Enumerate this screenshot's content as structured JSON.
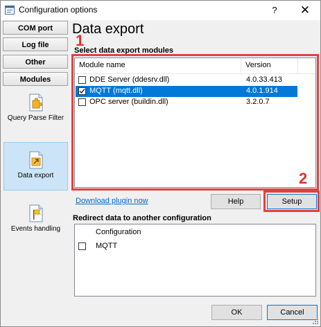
{
  "window": {
    "title": "Configuration options",
    "help_glyph": "?",
    "close_glyph": "✕"
  },
  "sidebar": {
    "tabs": [
      "COM port",
      "Log file",
      "Other",
      "Modules"
    ],
    "items": [
      {
        "label": "Query Parse Filter",
        "icon": "puzzle-document-icon"
      },
      {
        "label": "Data export",
        "icon": "export-document-icon"
      },
      {
        "label": "Events handling",
        "icon": "flag-document-icon"
      }
    ],
    "active_item": "Data export"
  },
  "main": {
    "heading": "Data export",
    "modules_label": "Select data export modules",
    "columns": {
      "name": "Module name",
      "version": "Version"
    },
    "modules": [
      {
        "name": "DDE Server (ddesrv.dll)",
        "version": "4.0.33.413",
        "checked": false,
        "selected": false
      },
      {
        "name": "MQTT (mqtt.dll)",
        "version": "4.0.1.914",
        "checked": true,
        "selected": true
      },
      {
        "name": "OPC server (buildin.dll)",
        "version": "3.2.0.7",
        "checked": false,
        "selected": false
      }
    ],
    "download_link": "Download plugin now",
    "help_button": "Help",
    "setup_button": "Setup",
    "redirect_label": "Redirect data to another configuration",
    "config_column": "Configuration",
    "configs": [
      {
        "name": "MQTT",
        "checked": false
      }
    ]
  },
  "annotations": {
    "marker1": "1",
    "marker2": "2",
    "color": "#e14141"
  },
  "footer": {
    "ok_button": "OK",
    "cancel_button": "Cancel"
  },
  "colors": {
    "selection": "#0078d7",
    "link": "#0066cc",
    "active_nav": "#cce4f7"
  }
}
